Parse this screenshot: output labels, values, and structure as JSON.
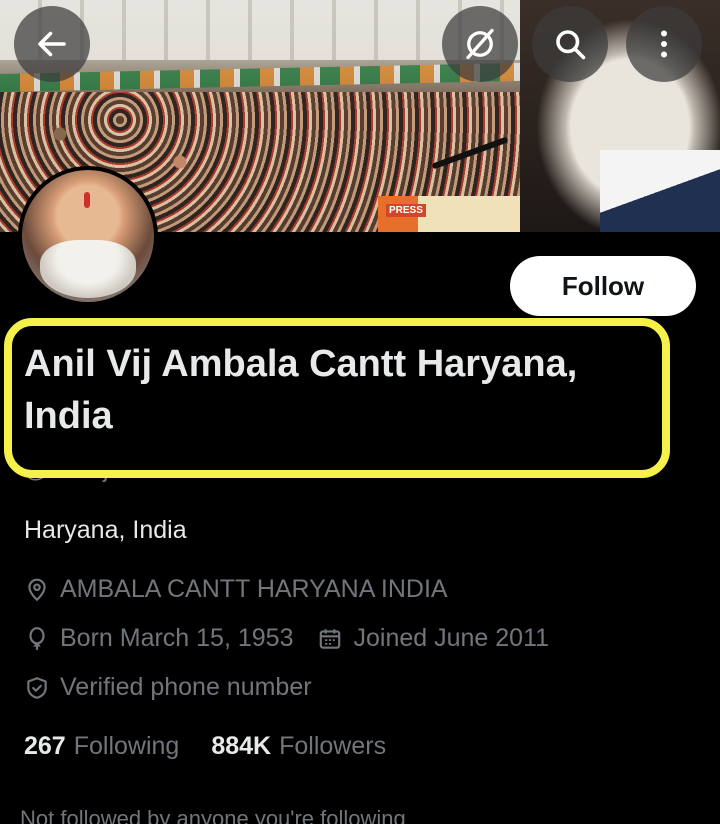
{
  "header": {
    "banner_sign": "PRESS",
    "buttons": {
      "back": "arrow-left-icon",
      "grok": "grok-slash-icon",
      "search": "search-icon",
      "more": "more-vertical-icon"
    }
  },
  "profile": {
    "display_name": "Anil Vij Ambala Cantt Haryana, India",
    "handle": "@anilvijminister",
    "follow_label": "Follow",
    "bio": "Haryana, India",
    "location": "AMBALA CANTT HARYANA INDIA",
    "birthday": "Born March 15, 1953",
    "joined": "Joined June 2011",
    "verified": "Verified phone number",
    "stats": {
      "following_count": "267",
      "following_label": "Following",
      "followers_count": "884K",
      "followers_label": "Followers"
    },
    "not_followed": "Not followed by anyone you're following"
  },
  "colors": {
    "background": "#000000",
    "highlight": "#f5f14a",
    "text_primary": "#e7e9ea",
    "text_secondary": "#71767b",
    "follow_bg": "#ffffff"
  }
}
